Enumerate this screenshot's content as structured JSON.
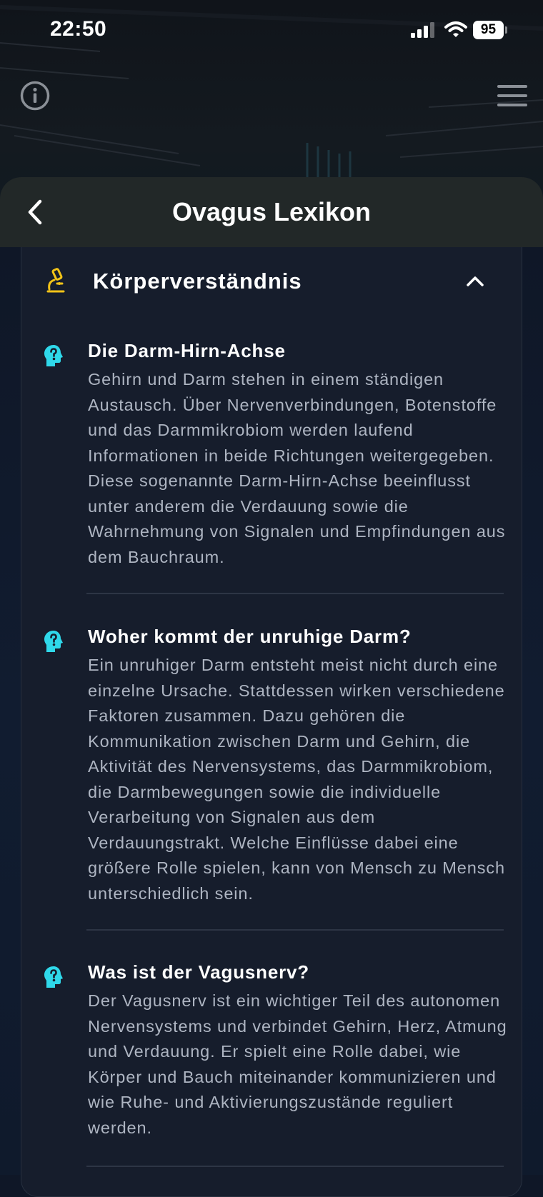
{
  "status_bar": {
    "time": "22:50",
    "battery": "95"
  },
  "header": {
    "title": "Ovagus Lexikon"
  },
  "section": {
    "title": "Körperverständnis",
    "icon": "microscope-icon"
  },
  "faq": [
    {
      "question": "Die Darm-Hirn-Achse",
      "answer": "Gehirn und Darm stehen in einem ständigen Austausch. Über Nervenverbindungen, Botenstoffe und das Darmmikrobiom werden laufend Informationen in beide Richtungen weitergegeben. Diese sogenannte Darm-Hirn-Achse beeinflusst unter anderem die Verdauung sowie die Wahrnehmung von Signalen und Empfindungen aus dem Bauchraum."
    },
    {
      "question": "Woher kommt der unruhige Darm?",
      "answer": "Ein unruhiger Darm entsteht meist nicht durch eine einzelne Ursache. Stattdessen wirken verschiedene Faktoren zusammen. Dazu gehören die Kommunikation zwischen Darm und Gehirn, die Aktivität des Nervensystems, das Darmmikrobiom, die Darmbewegungen sowie die individuelle Verarbeitung von Signalen aus dem Verdauungstrakt. Welche Einflüsse dabei eine größere Rolle spielen, kann von Mensch zu Mensch unterschiedlich sein."
    },
    {
      "question": "Was ist der Vagusnerv?",
      "answer": "Der Vagusnerv ist ein wichtiger Teil des autonomen Nervensystems und verbindet Gehirn, Herz, Atmung und Verdauung. Er spielt eine Rolle dabei, wie Körper und Bauch miteinander kommunizieren und wie Ruhe- und Aktivierungszustände reguliert werden."
    }
  ],
  "colors": {
    "accent_cyan": "#2fd8ea",
    "accent_yellow": "#f2c318",
    "header_bg": "#222828",
    "card_bg": "#161d2c"
  }
}
